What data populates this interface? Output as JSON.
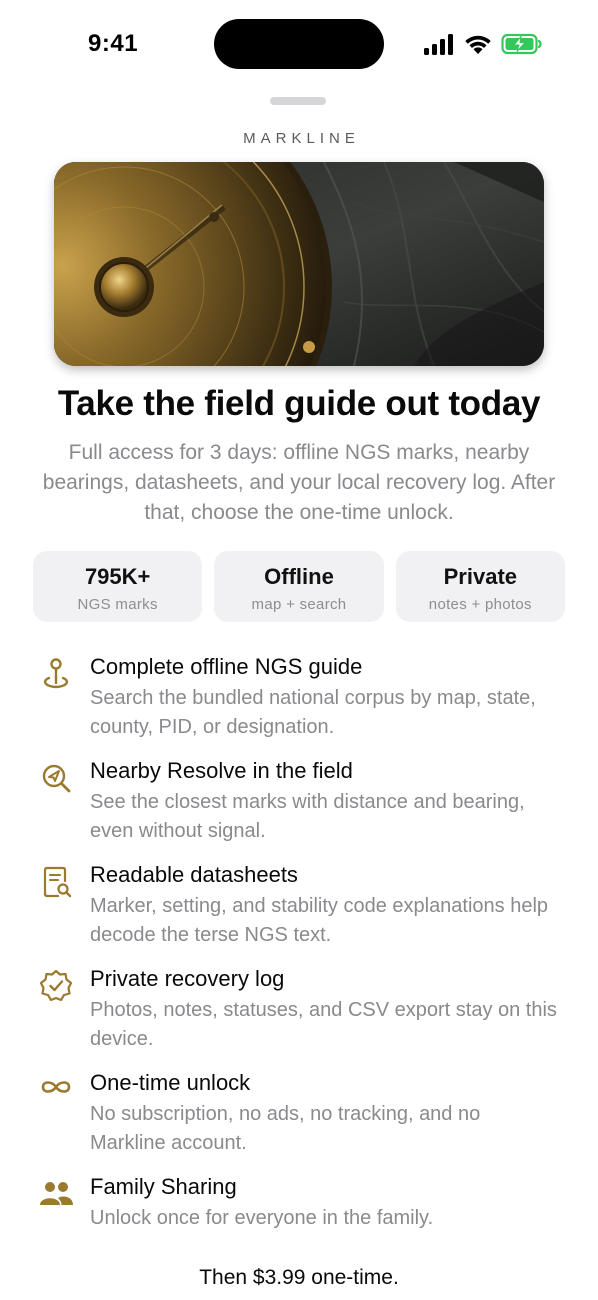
{
  "status_bar": {
    "time": "9:41"
  },
  "brand": "MARKLINE",
  "hero": {
    "alt": "Brass surveying compass on a dark topographic map"
  },
  "headline": "Take the field guide out today",
  "subtitle": "Full access for 3 days: offline NGS marks, nearby bearings, datasheets, and your local recovery log. After that, choose the one-time unlock.",
  "stats": [
    {
      "value": "795K+",
      "label": "NGS marks"
    },
    {
      "value": "Offline",
      "label": "map + search"
    },
    {
      "value": "Private",
      "label": "notes + photos"
    }
  ],
  "features": [
    {
      "icon": "map-pin-icon",
      "title": "Complete offline NGS guide",
      "desc": "Search the bundled national corpus by map, state, county, PID, or designation."
    },
    {
      "icon": "location-search-icon",
      "title": "Nearby Resolve in the field",
      "desc": "See the closest marks with distance and bearing, even without signal."
    },
    {
      "icon": "document-search-icon",
      "title": "Readable datasheets",
      "desc": "Marker, setting, and stability code explanations help decode the terse NGS text."
    },
    {
      "icon": "verified-badge-icon",
      "title": "Private recovery log",
      "desc": "Photos, notes, statuses, and CSV export stay on this device."
    },
    {
      "icon": "infinity-icon",
      "title": "One-time unlock",
      "desc": "No subscription, no ads, no tracking, and no Markline account."
    },
    {
      "icon": "family-icon",
      "title": "Family Sharing",
      "desc": "Unlock once for everyone in the family."
    }
  ],
  "price_line": "Then $3.99 one-time.",
  "colors": {
    "accent": "#9a7a2e",
    "secondary_text": "#8a8a8e",
    "card_bg": "#f1f1f4",
    "battery": "#34c759"
  }
}
